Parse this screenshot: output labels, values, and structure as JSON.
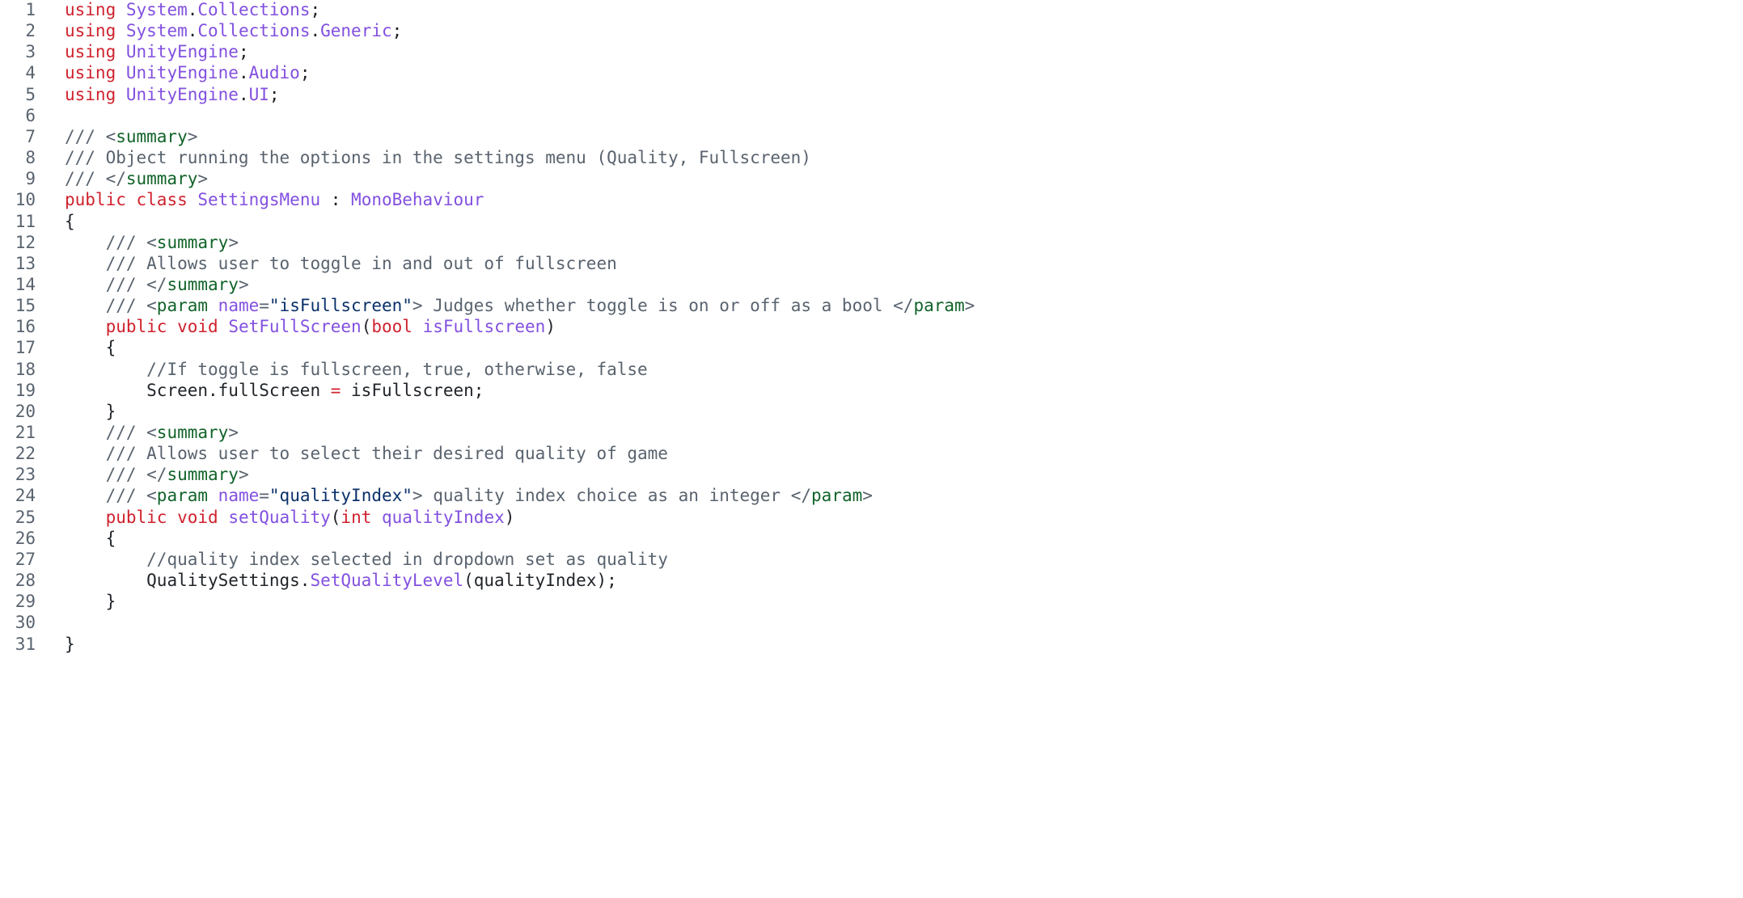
{
  "code": {
    "language": "csharp",
    "colors": {
      "keyword": "#cf222e",
      "entity": "#8250df",
      "text": "#1f2328",
      "comment": "#59636e",
      "tag": "#116329",
      "string": "#0a3069",
      "line_number": "#59636e",
      "background": "#ffffff"
    },
    "lines": [
      {
        "n": "1",
        "indent": "",
        "tokens": [
          [
            "kw",
            "using"
          ],
          [
            "txt",
            " "
          ],
          [
            "ent",
            "System"
          ],
          [
            "txt",
            "."
          ],
          [
            "ent",
            "Collections"
          ],
          [
            "txt",
            ";"
          ]
        ]
      },
      {
        "n": "2",
        "indent": "",
        "tokens": [
          [
            "kw",
            "using"
          ],
          [
            "txt",
            " "
          ],
          [
            "ent",
            "System"
          ],
          [
            "txt",
            "."
          ],
          [
            "ent",
            "Collections"
          ],
          [
            "txt",
            "."
          ],
          [
            "ent",
            "Generic"
          ],
          [
            "txt",
            ";"
          ]
        ]
      },
      {
        "n": "3",
        "indent": "",
        "tokens": [
          [
            "kw",
            "using"
          ],
          [
            "txt",
            " "
          ],
          [
            "ent",
            "UnityEngine"
          ],
          [
            "txt",
            ";"
          ]
        ]
      },
      {
        "n": "4",
        "indent": "",
        "tokens": [
          [
            "kw",
            "using"
          ],
          [
            "txt",
            " "
          ],
          [
            "ent",
            "UnityEngine"
          ],
          [
            "txt",
            "."
          ],
          [
            "ent",
            "Audio"
          ],
          [
            "txt",
            ";"
          ]
        ]
      },
      {
        "n": "5",
        "indent": "",
        "tokens": [
          [
            "kw",
            "using"
          ],
          [
            "txt",
            " "
          ],
          [
            "ent",
            "UnityEngine"
          ],
          [
            "txt",
            "."
          ],
          [
            "ent",
            "UI"
          ],
          [
            "txt",
            ";"
          ]
        ]
      },
      {
        "n": "6",
        "indent": "",
        "tokens": []
      },
      {
        "n": "7",
        "indent": "",
        "tokens": [
          [
            "cmt",
            "/// <"
          ],
          [
            "tag",
            "summary"
          ],
          [
            "cmt",
            ">"
          ]
        ]
      },
      {
        "n": "8",
        "indent": "",
        "tokens": [
          [
            "cmt",
            "/// Object running the options in the settings menu (Quality, Fullscreen)"
          ]
        ]
      },
      {
        "n": "9",
        "indent": "",
        "tokens": [
          [
            "cmt",
            "/// </"
          ],
          [
            "tag",
            "summary"
          ],
          [
            "cmt",
            ">"
          ]
        ]
      },
      {
        "n": "10",
        "indent": "",
        "tokens": [
          [
            "kw",
            "public"
          ],
          [
            "txt",
            " "
          ],
          [
            "kw",
            "class"
          ],
          [
            "txt",
            " "
          ],
          [
            "ent",
            "SettingsMenu"
          ],
          [
            "txt",
            " : "
          ],
          [
            "ent",
            "MonoBehaviour"
          ]
        ]
      },
      {
        "n": "11",
        "indent": "",
        "tokens": [
          [
            "txt",
            "{"
          ]
        ]
      },
      {
        "n": "12",
        "indent": "    ",
        "tokens": [
          [
            "cmt",
            "/// <"
          ],
          [
            "tag",
            "summary"
          ],
          [
            "cmt",
            ">"
          ]
        ]
      },
      {
        "n": "13",
        "indent": "    ",
        "tokens": [
          [
            "cmt",
            "/// Allows user to toggle in and out of fullscreen"
          ]
        ]
      },
      {
        "n": "14",
        "indent": "    ",
        "tokens": [
          [
            "cmt",
            "/// </"
          ],
          [
            "tag",
            "summary"
          ],
          [
            "cmt",
            ">"
          ]
        ]
      },
      {
        "n": "15",
        "indent": "    ",
        "tokens": [
          [
            "cmt",
            "/// <"
          ],
          [
            "tag",
            "param"
          ],
          [
            "cmt",
            " "
          ],
          [
            "ent",
            "name"
          ],
          [
            "cmt",
            "="
          ],
          [
            "str",
            "\"isFullscreen\""
          ],
          [
            "cmt",
            "> Judges whether toggle is on or off as a bool </"
          ],
          [
            "tag",
            "param"
          ],
          [
            "cmt",
            ">"
          ]
        ]
      },
      {
        "n": "16",
        "indent": "    ",
        "tokens": [
          [
            "kw",
            "public"
          ],
          [
            "txt",
            " "
          ],
          [
            "kw",
            "void"
          ],
          [
            "txt",
            " "
          ],
          [
            "ent",
            "SetFullScreen"
          ],
          [
            "txt",
            "("
          ],
          [
            "kw",
            "bool"
          ],
          [
            "txt",
            " "
          ],
          [
            "ent",
            "isFullscreen"
          ],
          [
            "txt",
            ")"
          ]
        ]
      },
      {
        "n": "17",
        "indent": "    ",
        "tokens": [
          [
            "txt",
            "{"
          ]
        ]
      },
      {
        "n": "18",
        "indent": "        ",
        "tokens": [
          [
            "cmt",
            "//If toggle is fullscreen, true, otherwise, false"
          ]
        ]
      },
      {
        "n": "19",
        "indent": "        ",
        "tokens": [
          [
            "txt",
            "Screen.fullScreen "
          ],
          [
            "kw",
            "="
          ],
          [
            "txt",
            " isFullscreen;"
          ]
        ]
      },
      {
        "n": "20",
        "indent": "    ",
        "tokens": [
          [
            "txt",
            "}"
          ]
        ]
      },
      {
        "n": "21",
        "indent": "    ",
        "tokens": [
          [
            "cmt",
            "/// <"
          ],
          [
            "tag",
            "summary"
          ],
          [
            "cmt",
            ">"
          ]
        ]
      },
      {
        "n": "22",
        "indent": "    ",
        "tokens": [
          [
            "cmt",
            "/// Allows user to select their desired quality of game"
          ]
        ]
      },
      {
        "n": "23",
        "indent": "    ",
        "tokens": [
          [
            "cmt",
            "/// </"
          ],
          [
            "tag",
            "summary"
          ],
          [
            "cmt",
            ">"
          ]
        ]
      },
      {
        "n": "24",
        "indent": "    ",
        "tokens": [
          [
            "cmt",
            "/// <"
          ],
          [
            "tag",
            "param"
          ],
          [
            "cmt",
            " "
          ],
          [
            "ent",
            "name"
          ],
          [
            "cmt",
            "="
          ],
          [
            "str",
            "\"qualityIndex\""
          ],
          [
            "cmt",
            "> quality index choice as an integer </"
          ],
          [
            "tag",
            "param"
          ],
          [
            "cmt",
            ">"
          ]
        ]
      },
      {
        "n": "25",
        "indent": "    ",
        "tokens": [
          [
            "kw",
            "public"
          ],
          [
            "txt",
            " "
          ],
          [
            "kw",
            "void"
          ],
          [
            "txt",
            " "
          ],
          [
            "ent",
            "setQuality"
          ],
          [
            "txt",
            "("
          ],
          [
            "kw",
            "int"
          ],
          [
            "txt",
            " "
          ],
          [
            "ent",
            "qualityIndex"
          ],
          [
            "txt",
            ")"
          ]
        ]
      },
      {
        "n": "26",
        "indent": "    ",
        "tokens": [
          [
            "txt",
            "{"
          ]
        ]
      },
      {
        "n": "27",
        "indent": "        ",
        "tokens": [
          [
            "cmt",
            "//quality index selected in dropdown set as quality"
          ]
        ]
      },
      {
        "n": "28",
        "indent": "        ",
        "tokens": [
          [
            "txt",
            "QualitySettings."
          ],
          [
            "ent",
            "SetQualityLevel"
          ],
          [
            "txt",
            "(qualityIndex);"
          ]
        ]
      },
      {
        "n": "29",
        "indent": "    ",
        "tokens": [
          [
            "txt",
            "}"
          ]
        ]
      },
      {
        "n": "30",
        "indent": "",
        "tokens": []
      },
      {
        "n": "31",
        "indent": "",
        "tokens": [
          [
            "txt",
            "}"
          ]
        ]
      }
    ]
  }
}
